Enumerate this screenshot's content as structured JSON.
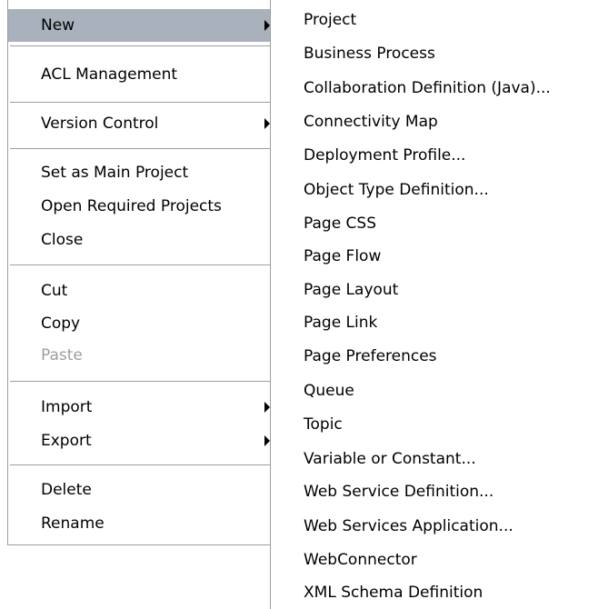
{
  "main_menu": {
    "new": "New",
    "acl_management": "ACL Management",
    "version_control": "Version Control",
    "set_as_main_project": "Set as Main Project",
    "open_required_projects": "Open Required Projects",
    "close": "Close",
    "cut": "Cut",
    "copy": "Copy",
    "paste": "Paste",
    "import": "Import",
    "export": "Export",
    "delete": "Delete",
    "rename": "Rename"
  },
  "submenu": {
    "items": [
      "Project",
      "Business Process",
      "Collaboration Definition (Java)...",
      "Connectivity Map",
      "Deployment Profile...",
      "Object Type Definition...",
      "Page CSS",
      "Page Flow",
      "Page Layout",
      "Page Link",
      "Page Preferences",
      "Queue",
      "Topic",
      "Variable or Constant...",
      "Web Service Definition...",
      "Web Services Application...",
      "WebConnector",
      "XML Schema Definition"
    ]
  },
  "colors": {
    "highlight": "#a9b1bd",
    "disabled_text": "#9e9e9e",
    "border": "#9d9d9d"
  }
}
